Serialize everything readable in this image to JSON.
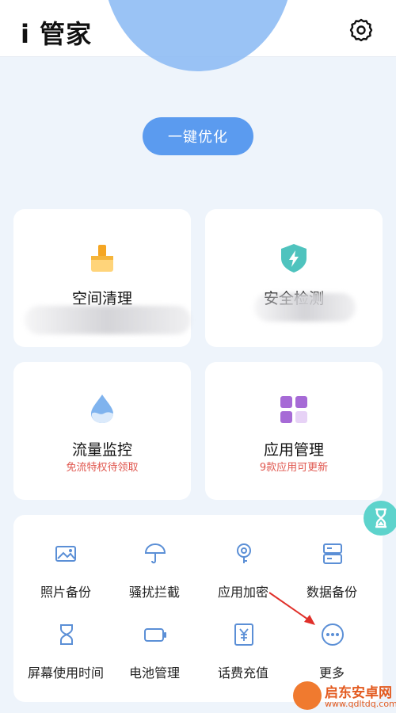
{
  "header": {
    "title": "i 管家"
  },
  "hero": {
    "optimize_label": "一键优化"
  },
  "cards": {
    "space_clean": {
      "title": "空间清理"
    },
    "security": {
      "title": "安全检测"
    },
    "traffic": {
      "title": "流量监控",
      "subtitle": "免流特权待领取"
    },
    "app_manage": {
      "title": "应用管理",
      "subtitle": "9款应用可更新"
    }
  },
  "tools": [
    {
      "label": "照片备份",
      "icon": "photo-icon"
    },
    {
      "label": "骚扰拦截",
      "icon": "umbrella-icon"
    },
    {
      "label": "应用加密",
      "icon": "lock-pin-icon"
    },
    {
      "label": "数据备份",
      "icon": "database-icon"
    },
    {
      "label": "屏幕使用时间",
      "icon": "hourglass-icon"
    },
    {
      "label": "电池管理",
      "icon": "battery-icon"
    },
    {
      "label": "话费充值",
      "icon": "yen-icon"
    },
    {
      "label": "更多",
      "icon": "more-icon"
    }
  ],
  "watermark": {
    "name": "启东安卓网",
    "url": "www.qdltdq.com"
  },
  "colors": {
    "accent": "#5b9bef",
    "icon_blue": "#5b8fd6",
    "warning_red": "#e0574f",
    "teal": "#4fc3be"
  }
}
